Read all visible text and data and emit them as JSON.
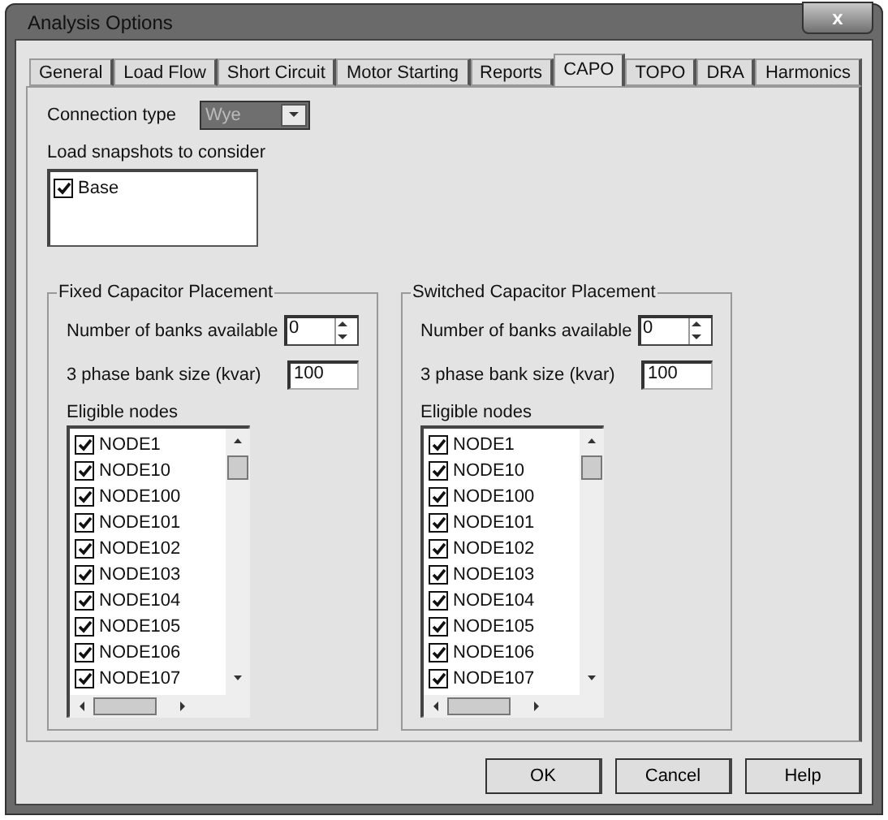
{
  "window": {
    "title": "Analysis Options",
    "close": "x"
  },
  "tabs": [
    {
      "label": "General",
      "selected": false
    },
    {
      "label": "Load Flow",
      "selected": false
    },
    {
      "label": "Short Circuit",
      "selected": false
    },
    {
      "label": "Motor Starting",
      "selected": false
    },
    {
      "label": "Reports",
      "selected": false
    },
    {
      "label": "CAPO",
      "selected": true
    },
    {
      "label": "TOPO",
      "selected": false
    },
    {
      "label": "DRA",
      "selected": false
    },
    {
      "label": "Harmonics",
      "selected": false
    }
  ],
  "connection_type": {
    "label": "Connection type",
    "value": "Wye"
  },
  "load_snapshots": {
    "label": "Load snapshots to consider",
    "items": [
      {
        "label": "Base",
        "checked": true
      }
    ]
  },
  "groups": [
    {
      "title": "Fixed Capacitor Placement",
      "banks_label": "Number of banks available",
      "banks_value": "0",
      "size_label": "3 phase bank size (kvar)",
      "size_value": "100",
      "nodes_label": "Eligible nodes",
      "nodes": [
        {
          "label": "NODE1",
          "checked": true
        },
        {
          "label": "NODE10",
          "checked": true
        },
        {
          "label": "NODE100",
          "checked": true
        },
        {
          "label": "NODE101",
          "checked": true
        },
        {
          "label": "NODE102",
          "checked": true
        },
        {
          "label": "NODE103",
          "checked": true
        },
        {
          "label": "NODE104",
          "checked": true
        },
        {
          "label": "NODE105",
          "checked": true
        },
        {
          "label": "NODE106",
          "checked": true
        },
        {
          "label": "NODE107",
          "checked": true
        }
      ]
    },
    {
      "title": "Switched Capacitor Placement",
      "banks_label": "Number of banks available",
      "banks_value": "0",
      "size_label": "3 phase bank size (kvar)",
      "size_value": "100",
      "nodes_label": "Eligible nodes",
      "nodes": [
        {
          "label": "NODE1",
          "checked": true
        },
        {
          "label": "NODE10",
          "checked": true
        },
        {
          "label": "NODE100",
          "checked": true
        },
        {
          "label": "NODE101",
          "checked": true
        },
        {
          "label": "NODE102",
          "checked": true
        },
        {
          "label": "NODE103",
          "checked": true
        },
        {
          "label": "NODE104",
          "checked": true
        },
        {
          "label": "NODE105",
          "checked": true
        },
        {
          "label": "NODE106",
          "checked": true
        },
        {
          "label": "NODE107",
          "checked": true
        }
      ]
    }
  ],
  "buttons": [
    {
      "label": "OK"
    },
    {
      "label": "Cancel"
    },
    {
      "label": "Help"
    }
  ]
}
